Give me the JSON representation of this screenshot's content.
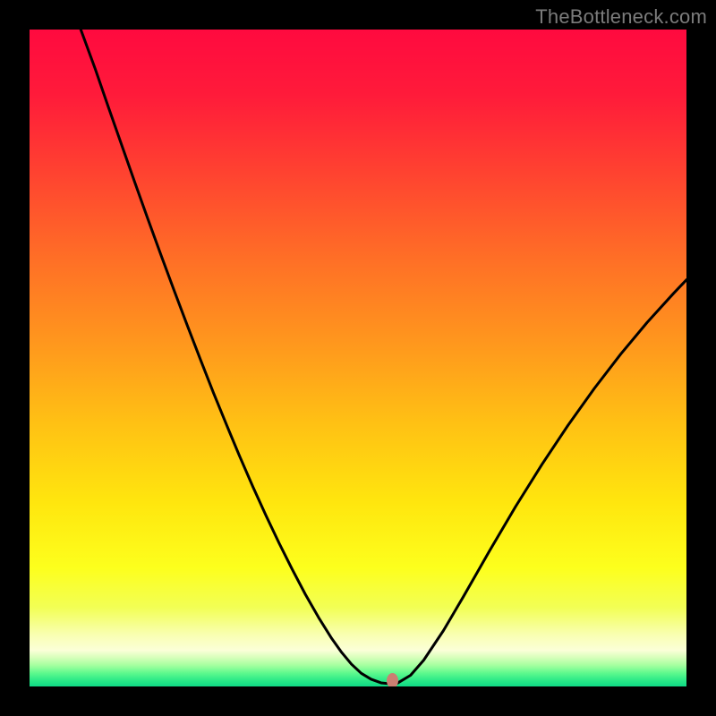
{
  "watermark": "TheBottleneck.com",
  "chart_data": {
    "type": "line",
    "title": "",
    "xlabel": "",
    "ylabel": "",
    "xlim": [
      0,
      100
    ],
    "ylim": [
      0,
      100
    ],
    "legend": false,
    "grid": false,
    "annotations": [],
    "background_gradient": {
      "stops": [
        {
          "offset": 0.0,
          "color": "#ff0a3f"
        },
        {
          "offset": 0.1,
          "color": "#ff1b3a"
        },
        {
          "offset": 0.22,
          "color": "#ff4330"
        },
        {
          "offset": 0.35,
          "color": "#ff6f26"
        },
        {
          "offset": 0.48,
          "color": "#ff981d"
        },
        {
          "offset": 0.6,
          "color": "#ffc114"
        },
        {
          "offset": 0.72,
          "color": "#ffe60e"
        },
        {
          "offset": 0.82,
          "color": "#fdff1d"
        },
        {
          "offset": 0.88,
          "color": "#f2ff55"
        },
        {
          "offset": 0.922,
          "color": "#f9ffb3"
        },
        {
          "offset": 0.945,
          "color": "#fbffd8"
        },
        {
          "offset": 0.956,
          "color": "#d7ffba"
        },
        {
          "offset": 0.968,
          "color": "#a4ff9f"
        },
        {
          "offset": 0.98,
          "color": "#5cf98d"
        },
        {
          "offset": 0.992,
          "color": "#26e787"
        },
        {
          "offset": 1.0,
          "color": "#0fd985"
        }
      ]
    },
    "series": [
      {
        "name": "bottleneck-curve",
        "stroke": "#000000",
        "stroke_width": 2,
        "x": [
          7.8,
          10,
          12,
          14,
          16,
          18,
          20,
          22,
          24,
          26,
          28,
          30,
          32,
          34,
          36,
          38,
          40,
          42,
          44,
          46,
          47.5,
          49,
          50.5,
          52,
          53.5,
          55,
          56,
          58,
          60,
          63,
          66,
          70,
          74,
          78,
          82,
          86,
          90,
          94,
          98,
          100
        ],
        "y": [
          100,
          94.0,
          88.2,
          82.5,
          76.8,
          71.2,
          65.7,
          60.3,
          55.0,
          49.8,
          44.7,
          39.8,
          35.0,
          30.4,
          26.0,
          21.8,
          17.8,
          14.0,
          10.5,
          7.3,
          5.2,
          3.4,
          2.0,
          1.1,
          0.55,
          0.4,
          0.5,
          1.7,
          4.0,
          8.5,
          13.6,
          20.6,
          27.4,
          33.8,
          39.8,
          45.4,
          50.6,
          55.4,
          59.8,
          61.9
        ]
      }
    ],
    "marker": {
      "name": "optimal-point",
      "x": 55.3,
      "y": 0.9,
      "color": "#cb7f72"
    }
  }
}
